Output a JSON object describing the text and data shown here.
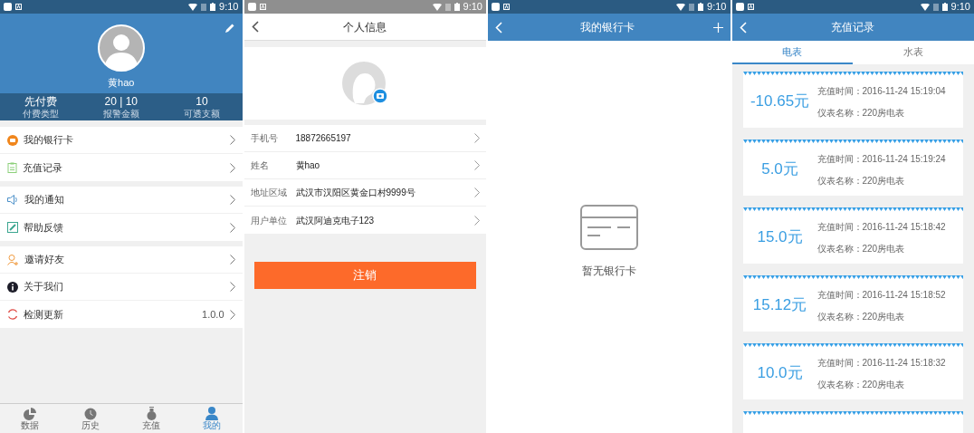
{
  "profile_screen": {
    "status_bar": {
      "time": "9:10"
    },
    "user_name": "黄hao",
    "stats": [
      {
        "value": "先付费",
        "label": "付费类型"
      },
      {
        "value": "20 | 10",
        "label": "报警金额"
      },
      {
        "value": "10",
        "label": "可透支额"
      }
    ],
    "menu_groups": [
      [
        {
          "label": "我的银行卡"
        },
        {
          "label": "充值记录"
        }
      ],
      [
        {
          "label": "我的通知"
        },
        {
          "label": "帮助反馈"
        }
      ],
      [
        {
          "label": "邀请好友"
        },
        {
          "label": "关于我们"
        },
        {
          "label": "检测更新",
          "value": "1.0.0"
        }
      ]
    ],
    "bottom_nav": [
      {
        "label": "数据",
        "selected": false
      },
      {
        "label": "历史",
        "selected": false
      },
      {
        "label": "充值",
        "selected": false
      },
      {
        "label": "我的",
        "selected": true
      }
    ]
  },
  "personal_info_screen": {
    "status_bar": {
      "time": "9:10"
    },
    "title": "个人信息",
    "fields": [
      {
        "label": "手机号",
        "value": "18872665197"
      },
      {
        "label": "姓名",
        "value": "黄hao"
      },
      {
        "label": "地址区域",
        "value": "武汉市汉阳区黄金口村9999号"
      },
      {
        "label": "用户单位",
        "value": "武汉阿迪克电子123"
      }
    ],
    "logout_button": "注销"
  },
  "bank_card_screen": {
    "status_bar": {
      "time": "9:10"
    },
    "title": "我的银行卡",
    "empty_text": "暂无银行卡"
  },
  "recharge_records_screen": {
    "status_bar": {
      "time": "9:10"
    },
    "title": "充值记录",
    "tabs": [
      {
        "label": "电表",
        "selected": true
      },
      {
        "label": "水表",
        "selected": false
      }
    ],
    "records": [
      {
        "amount": "-10.65元",
        "time": "充值时间：2016-11-24 15:19:04",
        "meter": "仪表名称：220房电表"
      },
      {
        "amount": "5.0元",
        "time": "充值时间：2016-11-24 15:19:24",
        "meter": "仪表名称：220房电表"
      },
      {
        "amount": "15.0元",
        "time": "充值时间：2016-11-24 15:18:42",
        "meter": "仪表名称：220房电表"
      },
      {
        "amount": "15.12元",
        "time": "充值时间：2016-11-24 15:18:52",
        "meter": "仪表名称：220房电表"
      },
      {
        "amount": "10.0元",
        "time": "充值时间：2016-11-24 15:18:32",
        "meter": "仪表名称：220房电表"
      }
    ]
  }
}
